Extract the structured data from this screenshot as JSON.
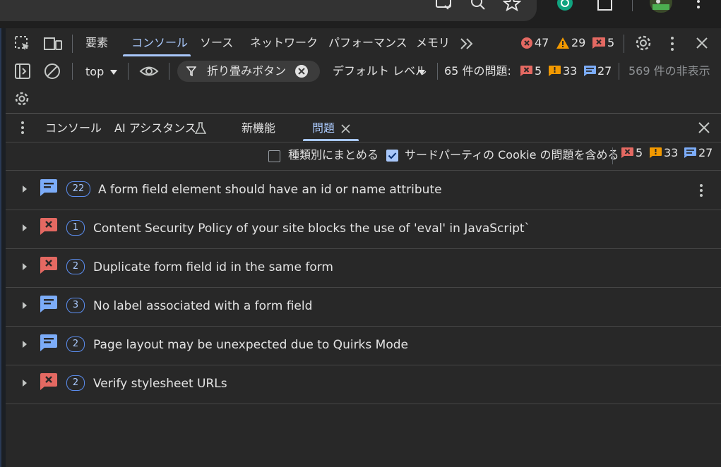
{
  "toolbar": {
    "tabs": [
      "要素",
      "コンソール",
      "ソース",
      "ネットワーク",
      "パフォーマンス",
      "メモリ"
    ],
    "more_tabs_icon": "double-chevron-right-icon",
    "error_count": "47",
    "warning_count": "29",
    "issue_count": "5"
  },
  "console_bar": {
    "context": "top",
    "filter_label": "折り畳みボタン",
    "level": "デフォルト レベル",
    "issues_label": "65 件の問題:",
    "err": "5",
    "warn": "33",
    "info": "27",
    "hidden": "569 件の非表示"
  },
  "drawer": {
    "tabs": [
      "コンソール",
      "AI アシスタンス",
      "新機能",
      "問題"
    ],
    "options": {
      "group_by_kind": "種類別にまとめる",
      "include_third_party": "サードパーティの Cookie の問題を含める"
    },
    "counts": {
      "err": "5",
      "warn": "33",
      "info": "27"
    }
  },
  "issues": [
    {
      "kind": "info",
      "count": "22",
      "text": "A form field element should have an id or name attribute"
    },
    {
      "kind": "error",
      "count": "1",
      "text": "Content Security Policy of your site blocks the use of 'eval' in JavaScript`"
    },
    {
      "kind": "error",
      "count": "2",
      "text": "Duplicate form field id in the same form"
    },
    {
      "kind": "info",
      "count": "3",
      "text": "No label associated with a form field"
    },
    {
      "kind": "info",
      "count": "2",
      "text": "Page layout may be unexpected due to Quirks Mode"
    },
    {
      "kind": "error",
      "count": "2",
      "text": "Verify stylesheet URLs"
    }
  ],
  "colors": {
    "accent": "#a8c7fa",
    "error": "#e46962",
    "warning": "#f29900",
    "info": "#7cacf8"
  }
}
